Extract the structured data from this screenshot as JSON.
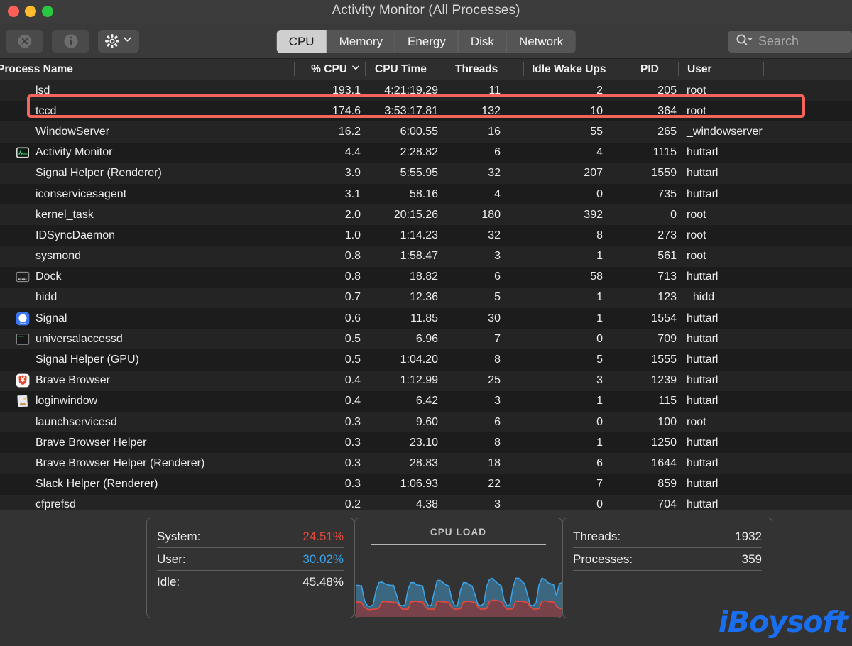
{
  "window": {
    "title": "Activity Monitor (All Processes)",
    "traffic_lights": [
      "close",
      "minimize",
      "zoom"
    ]
  },
  "toolbar": {
    "buttons": [
      {
        "name": "quit-process-button",
        "icon": "stop-octagon-icon",
        "enabled": false
      },
      {
        "name": "inspect-process-button",
        "icon": "info-circle-icon",
        "enabled": false
      },
      {
        "name": "view-options-button",
        "icon": "gear-icon",
        "enabled": true
      }
    ],
    "tabs": [
      {
        "label": "CPU",
        "active": true
      },
      {
        "label": "Memory",
        "active": false
      },
      {
        "label": "Energy",
        "active": false
      },
      {
        "label": "Disk",
        "active": false
      },
      {
        "label": "Network",
        "active": false
      }
    ],
    "search": {
      "placeholder": "Search",
      "value": "",
      "icon": "search-icon"
    }
  },
  "table": {
    "columns": [
      {
        "key": "name",
        "label": "Process Name"
      },
      {
        "key": "cpu",
        "label": "% CPU",
        "sorted": true,
        "sort_direction": "descending"
      },
      {
        "key": "cputime",
        "label": "CPU Time"
      },
      {
        "key": "threads",
        "label": "Threads"
      },
      {
        "key": "idle",
        "label": "Idle Wake Ups"
      },
      {
        "key": "pid",
        "label": "PID"
      },
      {
        "key": "user",
        "label": "User"
      }
    ],
    "rows": [
      {
        "name": "lsd",
        "icon": "none",
        "cpu": "193.1",
        "cputime": "4:21:19.29",
        "threads": "11",
        "idle": "2",
        "pid": "205",
        "user": "root"
      },
      {
        "name": "tccd",
        "icon": "none",
        "cpu": "174.6",
        "cputime": "3:53:17.81",
        "threads": "132",
        "idle": "10",
        "pid": "364",
        "user": "root",
        "highlighted": true
      },
      {
        "name": "WindowServer",
        "icon": "none",
        "cpu": "16.2",
        "cputime": "6:00.55",
        "threads": "16",
        "idle": "55",
        "pid": "265",
        "user": "_windowserver"
      },
      {
        "name": "Activity Monitor",
        "icon": "activity-monitor",
        "cpu": "4.4",
        "cputime": "2:28.82",
        "threads": "6",
        "idle": "4",
        "pid": "1115",
        "user": "huttarl"
      },
      {
        "name": "Signal Helper (Renderer)",
        "icon": "none",
        "cpu": "3.9",
        "cputime": "5:55.95",
        "threads": "32",
        "idle": "207",
        "pid": "1559",
        "user": "huttarl"
      },
      {
        "name": "iconservicesagent",
        "icon": "none",
        "cpu": "3.1",
        "cputime": "58.16",
        "threads": "4",
        "idle": "0",
        "pid": "735",
        "user": "huttarl"
      },
      {
        "name": "kernel_task",
        "icon": "none",
        "cpu": "2.0",
        "cputime": "20:15.26",
        "threads": "180",
        "idle": "392",
        "pid": "0",
        "user": "root"
      },
      {
        "name": "IDSyncDaemon",
        "icon": "none",
        "cpu": "1.0",
        "cputime": "1:14.23",
        "threads": "32",
        "idle": "8",
        "pid": "273",
        "user": "root"
      },
      {
        "name": "sysmond",
        "icon": "none",
        "cpu": "0.8",
        "cputime": "1:58.47",
        "threads": "3",
        "idle": "1",
        "pid": "561",
        "user": "root"
      },
      {
        "name": "Dock",
        "icon": "dock",
        "cpu": "0.8",
        "cputime": "18.82",
        "threads": "6",
        "idle": "58",
        "pid": "713",
        "user": "huttarl"
      },
      {
        "name": "hidd",
        "icon": "none",
        "cpu": "0.7",
        "cputime": "12.36",
        "threads": "5",
        "idle": "1",
        "pid": "123",
        "user": "_hidd"
      },
      {
        "name": "Signal",
        "icon": "signal",
        "cpu": "0.6",
        "cputime": "11.85",
        "threads": "30",
        "idle": "1",
        "pid": "1554",
        "user": "huttarl"
      },
      {
        "name": "universalaccessd",
        "icon": "terminal",
        "cpu": "0.5",
        "cputime": "6.96",
        "threads": "7",
        "idle": "0",
        "pid": "709",
        "user": "huttarl"
      },
      {
        "name": "Signal Helper (GPU)",
        "icon": "none",
        "cpu": "0.5",
        "cputime": "1:04.20",
        "threads": "8",
        "idle": "5",
        "pid": "1555",
        "user": "huttarl"
      },
      {
        "name": "Brave Browser",
        "icon": "brave",
        "cpu": "0.4",
        "cputime": "1:12.99",
        "threads": "25",
        "idle": "3",
        "pid": "1239",
        "user": "huttarl"
      },
      {
        "name": "loginwindow",
        "icon": "loginwindow",
        "cpu": "0.4",
        "cputime": "6.42",
        "threads": "3",
        "idle": "1",
        "pid": "115",
        "user": "huttarl"
      },
      {
        "name": "launchservicesd",
        "icon": "none",
        "cpu": "0.3",
        "cputime": "9.60",
        "threads": "6",
        "idle": "0",
        "pid": "100",
        "user": "root"
      },
      {
        "name": "Brave Browser Helper",
        "icon": "none",
        "cpu": "0.3",
        "cputime": "23.10",
        "threads": "8",
        "idle": "1",
        "pid": "1250",
        "user": "huttarl"
      },
      {
        "name": "Brave Browser Helper (Renderer)",
        "icon": "none",
        "cpu": "0.3",
        "cputime": "28.83",
        "threads": "18",
        "idle": "6",
        "pid": "1644",
        "user": "huttarl"
      },
      {
        "name": "Slack Helper (Renderer)",
        "icon": "none",
        "cpu": "0.3",
        "cputime": "1:06.93",
        "threads": "22",
        "idle": "7",
        "pid": "859",
        "user": "huttarl"
      },
      {
        "name": "cfprefsd",
        "icon": "none",
        "cpu": "0.2",
        "cputime": "4.38",
        "threads": "3",
        "idle": "0",
        "pid": "704",
        "user": "huttarl"
      }
    ]
  },
  "footer": {
    "cpu_stats": [
      {
        "label": "System:",
        "value": "24.51%",
        "color": "#e8483c"
      },
      {
        "label": "User:",
        "value": "30.02%",
        "color": "#3aa3e8"
      },
      {
        "label": "Idle:",
        "value": "45.48%",
        "color": "#efefef"
      }
    ],
    "graph": {
      "title": "CPU LOAD"
    },
    "counters": [
      {
        "label": "Threads:",
        "value": "1932"
      },
      {
        "label": "Processes:",
        "value": "359"
      }
    ],
    "watermark": "iBoysoft"
  },
  "chart_data": {
    "type": "area",
    "title": "CPU LOAD",
    "xlabel": "",
    "ylabel": "",
    "ylim": [
      0,
      100
    ],
    "legend": [
      "System",
      "User"
    ],
    "colors": {
      "system": "#e8483c",
      "user": "#3aa3e8"
    },
    "series": [
      {
        "name": "System",
        "color": "#e8483c",
        "values": [
          27,
          27,
          26,
          17,
          14,
          13,
          14,
          14,
          16,
          27,
          28,
          27,
          27,
          26,
          26,
          20,
          14,
          14,
          14,
          27,
          28,
          28,
          27,
          27,
          17,
          14,
          14,
          14,
          28,
          28,
          27,
          27,
          26,
          17,
          14,
          14,
          15,
          27,
          28,
          28,
          27,
          26,
          18,
          14,
          14,
          15,
          28,
          30,
          30,
          29,
          28,
          20,
          14,
          14,
          15,
          28,
          28,
          28,
          27,
          26,
          18,
          14,
          14,
          15,
          28,
          29,
          28,
          27,
          27,
          19,
          15,
          15
        ]
      },
      {
        "name": "User",
        "color": "#3aa3e8",
        "values": [
          57,
          57,
          56,
          30,
          20,
          19,
          22,
          48,
          62,
          63,
          60,
          58,
          57,
          57,
          40,
          22,
          20,
          22,
          50,
          62,
          62,
          58,
          57,
          56,
          30,
          20,
          21,
          45,
          66,
          66,
          62,
          58,
          56,
          32,
          20,
          21,
          48,
          62,
          62,
          58,
          56,
          40,
          22,
          20,
          24,
          55,
          68,
          70,
          64,
          60,
          56,
          30,
          20,
          22,
          52,
          70,
          70,
          65,
          60,
          40,
          21,
          20,
          26,
          58,
          70,
          68,
          62,
          60,
          58,
          38,
          60,
          62
        ]
      }
    ]
  }
}
